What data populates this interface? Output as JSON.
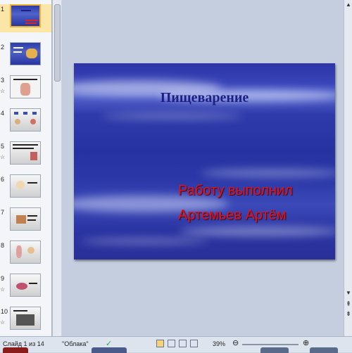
{
  "thumbnails": [
    {
      "number": "1",
      "starred": false,
      "selected": true
    },
    {
      "number": "2",
      "starred": false,
      "selected": false
    },
    {
      "number": "3",
      "starred": true,
      "selected": false
    },
    {
      "number": "4",
      "starred": false,
      "selected": false
    },
    {
      "number": "5",
      "starred": true,
      "selected": false
    },
    {
      "number": "6",
      "starred": false,
      "selected": false
    },
    {
      "number": "7",
      "starred": false,
      "selected": false
    },
    {
      "number": "8",
      "starred": false,
      "selected": false
    },
    {
      "number": "9",
      "starred": true,
      "selected": false
    },
    {
      "number": "10",
      "starred": true,
      "selected": false
    }
  ],
  "star_glyph": "☆",
  "slide": {
    "title": "Пищеварение",
    "author_line1": "Работу выполнил",
    "author_line2": "Артемьев Артём"
  },
  "statusbar": {
    "slide_info": "Слайд 1 из 14",
    "theme": "\"Облака\"",
    "zoom": "39%"
  },
  "colors": {
    "accent_selected": "#f0b030",
    "title_color": "#1b1f86",
    "author_color": "#e0121b"
  }
}
